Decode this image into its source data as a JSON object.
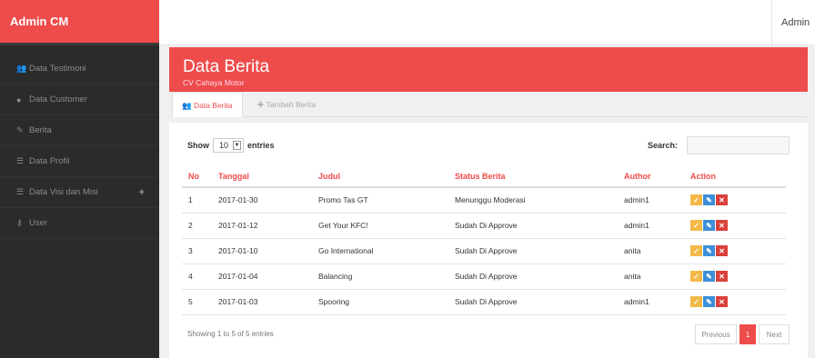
{
  "brand": "Admin CM",
  "user_menu": "Admin",
  "sidebar": {
    "items": [
      {
        "label": "Data Testimoni",
        "icon": "users-icon",
        "glyph": "👥"
      },
      {
        "label": "Data Customer",
        "icon": "chat-icon",
        "glyph": "●"
      },
      {
        "label": "Berita",
        "icon": "pencil-icon",
        "glyph": "✎"
      },
      {
        "label": "Data Profil",
        "icon": "list-icon",
        "glyph": "☰"
      },
      {
        "label": "Data Visi dan Misi",
        "icon": "list-icon",
        "glyph": "☰"
      },
      {
        "label": "User",
        "icon": "key-icon",
        "glyph": "⚷"
      }
    ]
  },
  "header": {
    "title": "Data Berita",
    "subtitle": "CV Cahaya Motor"
  },
  "tabs": [
    {
      "label": "Data Berita"
    },
    {
      "label": "Tambah Berita"
    }
  ],
  "controls": {
    "show_label": "Show",
    "entries_value": "10",
    "entries_label": "entries",
    "search_label": "Search:"
  },
  "table": {
    "columns": [
      "No",
      "Tanggal",
      "Judul",
      "Status Berita",
      "Author",
      "Action"
    ],
    "rows": [
      [
        "1",
        "2017-01-30",
        "Promo Tas GT",
        "Menunggu Moderasi",
        "admin1"
      ],
      [
        "2",
        "2017-01-12",
        "Get Your KFC!",
        "Sudah Di Approve",
        "admin1"
      ],
      [
        "3",
        "2017-01-10",
        "Go International",
        "Sudah Di Approve",
        "anita"
      ],
      [
        "4",
        "2017-01-04",
        "Balancing",
        "Sudah Di Approve",
        "anita"
      ],
      [
        "5",
        "2017-01-03",
        "Spooring",
        "Sudah Di Approve",
        "admin1"
      ]
    ]
  },
  "footer": {
    "info": "Showing 1 to 5 of 5 entries",
    "previous": "Previous",
    "current_page": "1",
    "next": "Next"
  },
  "colors": {
    "accent": "#ee4b4b",
    "sidebar_bg": "#2b2b2b",
    "approve": "#f3b948",
    "edit": "#3c8fd9",
    "delete": "#d9403a"
  }
}
